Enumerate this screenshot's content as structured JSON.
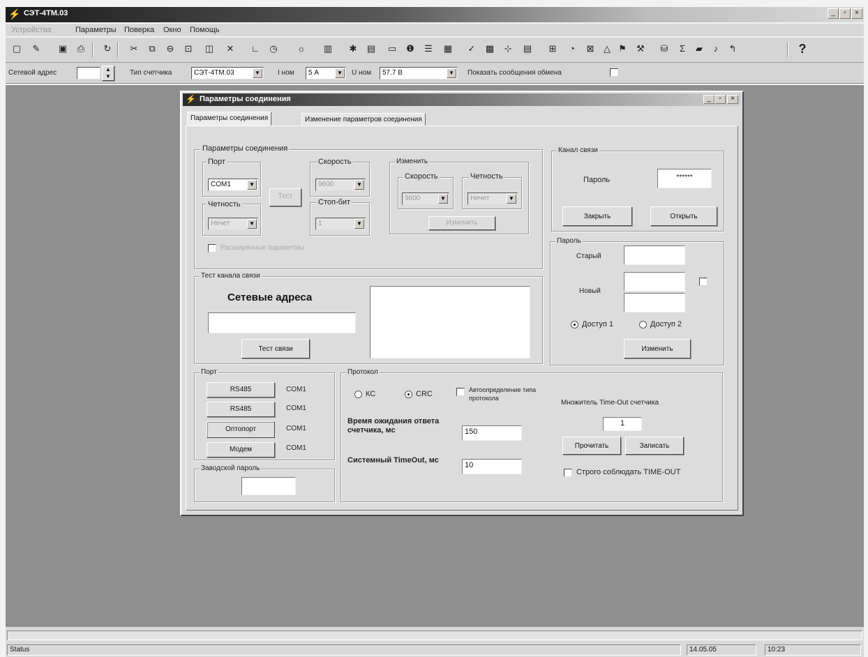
{
  "app": {
    "title": "СЭТ-4ТМ.03"
  },
  "window_controls": [
    "_",
    "▫",
    "×"
  ],
  "menu": [
    "Устройства",
    "Параметры",
    "Поверка",
    "Окно",
    "Помощь"
  ],
  "toolbar_icons": [
    "new-icon",
    "open-icon",
    "save-icon",
    "print-icon",
    "refresh-icon",
    "cut-icon",
    "copy-icon",
    "paste-icon",
    "connect-icon",
    "disconnect-icon",
    "delete-icon",
    "graph-icon",
    "clock-icon",
    "sun-icon",
    "chart-icon",
    "meter-icon",
    "table-icon",
    "window-icon",
    "info-icon",
    "list-icon",
    "grid-icon",
    "check-icon",
    "calendar-icon",
    "settings-icon",
    "report-icon",
    "car-icon",
    "timer-icon",
    "energy-icon",
    "triangle-icon",
    "flag-icon",
    "tools-icon",
    "db-icon",
    "sum-icon",
    "book-icon",
    "bell-icon",
    "arrow-icon",
    "help-icon"
  ],
  "addressbar": {
    "net_address_label": "Сетевой адрес",
    "net_address_value": "",
    "meter_type_label": "Тип счетчика",
    "meter_type_value": "СЭТ-4ТМ.03",
    "inom_label": "I ном",
    "inom_value": "5 А",
    "unom_label": "U ном",
    "unom_value": "57.7 В",
    "show_messages_label": "Показать сообщения обмена"
  },
  "dialog": {
    "title": "Параметры соединения",
    "controls": [
      "_",
      "▫",
      "×"
    ],
    "tabs": [
      "Параметры соединения",
      "Изменение параметров соединения"
    ],
    "conn_params": {
      "title": "Параметры соединения",
      "port_label": "Порт",
      "port_value": "COM1",
      "speed_label": "Скорость",
      "speed_value": "9600",
      "parity_label": "Четность",
      "parity_value": "Нечет",
      "stopbit_label": "Стоп-бит",
      "stopbit_value": "1",
      "test_button": "Тест",
      "advanced_label": "Расширенные параметры"
    },
    "change": {
      "title": "Изменить",
      "speed_label": "Скорость",
      "speed_value": "9600",
      "parity_label": "Четность",
      "parity_value": "Нечет",
      "button": "Изменить"
    },
    "channel": {
      "title": "Канал связи",
      "password_label": "Пароль",
      "password_value": "******",
      "close_button": "Закрыть",
      "open_button": "Открыть"
    },
    "password": {
      "title": "Пароль",
      "old_label": "Старый",
      "new_label": "Новый",
      "access1": "Доступ 1",
      "access2": "Доступ 2",
      "change_button": "Изменить"
    },
    "test": {
      "title": "Тест канала связи",
      "net_addr_header": "Сетевые адреса",
      "button": "Тест связи"
    },
    "port": {
      "title": "Порт",
      "rows": [
        {
          "button": "RS485",
          "value": "COM1"
        },
        {
          "button": "RS485",
          "value": "COM1"
        },
        {
          "button": "Оптопорт",
          "value": "COM1"
        },
        {
          "button": "Модем",
          "value": "COM1"
        }
      ]
    },
    "factory_password": {
      "title": "Заводской пароль"
    },
    "protocol": {
      "title": "Протокол",
      "ks": "КС",
      "crc": "CRC",
      "autodetect": "Автоопределение типа протокола",
      "wait_label": "Время ожидания ответа счетчика, мс",
      "wait_value": "150",
      "sys_timeout_label": "Системный TimeOut, мс",
      "sys_timeout_value": "10",
      "multiplier_label": "Множитель Time-Out счетчика",
      "multiplier_value": "1",
      "read_button": "Прочитать",
      "write_button": "Записать",
      "strict_label": "Строго соблюдать TIME-OUT"
    }
  },
  "status": {
    "text": "Status",
    "date": "14.05.05",
    "time": "10:23"
  }
}
